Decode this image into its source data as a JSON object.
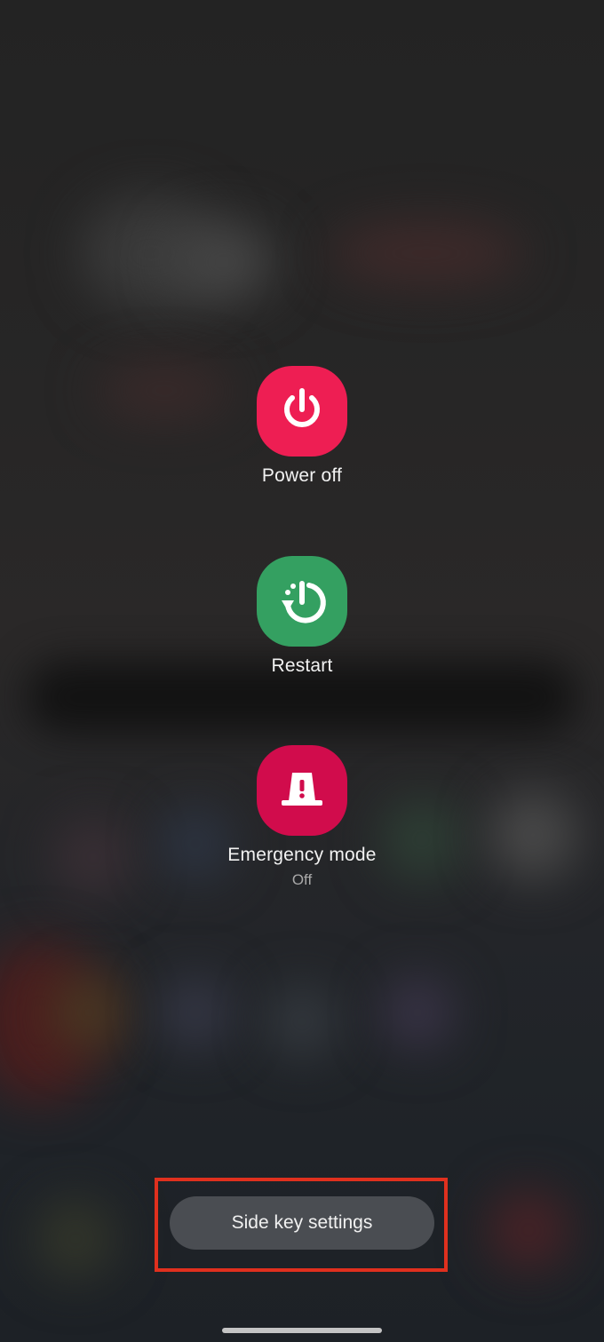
{
  "power_menu": {
    "power_off": {
      "label": "Power off",
      "icon": "power-icon",
      "color": "#ee1e53"
    },
    "restart": {
      "label": "Restart",
      "icon": "restart-icon",
      "color": "#34a061"
    },
    "emergency": {
      "label": "Emergency mode",
      "status": "Off",
      "icon": "emergency-light-icon",
      "color": "#d10c4c"
    }
  },
  "side_key": {
    "label": "Side key settings"
  },
  "highlight_color": "#e0301e"
}
